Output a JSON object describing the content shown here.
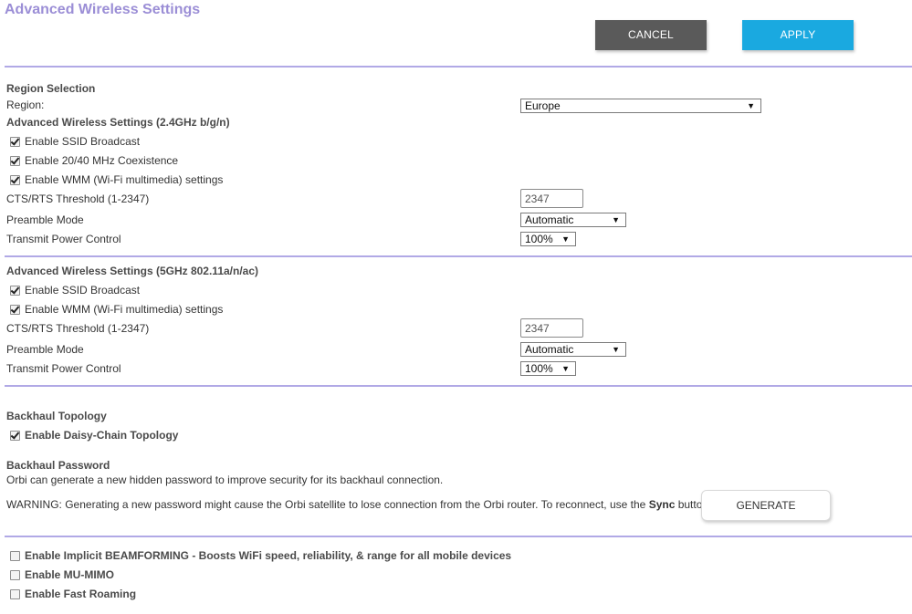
{
  "header": {
    "title": "Advanced Wireless Settings",
    "cancel_label": "CANCEL",
    "apply_label": "APPLY"
  },
  "region": {
    "heading": "Region Selection",
    "label": "Region:",
    "value": "Europe"
  },
  "band24": {
    "heading": "Advanced Wireless Settings (2.4GHz b/g/n)",
    "ssid_broadcast": "Enable SSID Broadcast",
    "coexistence": "Enable 20/40 MHz Coexistence",
    "wmm": "Enable WMM (Wi-Fi multimedia) settings",
    "cts_label": "CTS/RTS Threshold (1-2347)",
    "cts_value": "2347",
    "preamble_label": "Preamble Mode",
    "preamble_value": "Automatic",
    "power_label": "Transmit Power Control",
    "power_value": "100%"
  },
  "band5": {
    "heading": "Advanced Wireless Settings (5GHz 802.11a/n/ac)",
    "ssid_broadcast": "Enable SSID Broadcast",
    "wmm": "Enable WMM (Wi-Fi multimedia) settings",
    "cts_label": "CTS/RTS Threshold (1-2347)",
    "cts_value": "2347",
    "preamble_label": "Preamble Mode",
    "preamble_value": "Automatic",
    "power_label": "Transmit Power Control",
    "power_value": "100%"
  },
  "backhaul": {
    "topology_heading": "Backhaul Topology",
    "daisy_chain": "Enable Daisy-Chain Topology",
    "password_heading": "Backhaul Password",
    "password_desc": "Orbi can generate a new hidden password to improve security for its backhaul connection.",
    "warning_prefix": "WARNING: Generating a new password might cause the Orbi satellite to lose connection from the Orbi router. To reconnect, use the ",
    "warning_sync": "Sync",
    "warning_suffix": " button.",
    "generate_label": "GENERATE"
  },
  "extras": {
    "beamforming": "Enable Implicit BEAMFORMING - Boosts WiFi speed, reliability, & range for all mobile devices",
    "mu_mimo": "Enable MU-MIMO",
    "fast_roaming": "Enable Fast Roaming"
  },
  "icons": {
    "dropdown": "▼"
  },
  "colors": {
    "title": "#9b8ed6",
    "divider": "#b1a9e6",
    "cancel_bg": "#5a5a5a",
    "apply_bg": "#1aa9e0"
  }
}
